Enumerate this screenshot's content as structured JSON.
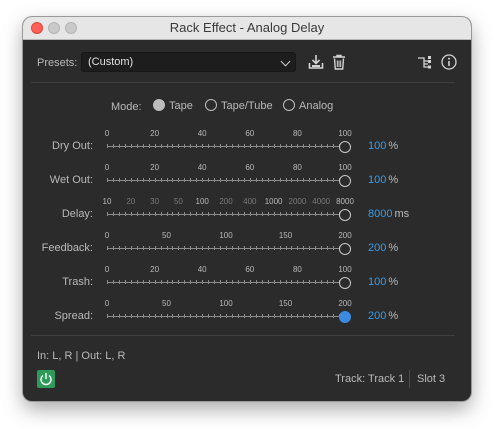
{
  "window": {
    "title": "Rack Effect - Analog Delay"
  },
  "presets": {
    "label": "Presets:",
    "value": "(Custom)",
    "icons": [
      "save-preset-icon",
      "trash-icon",
      "routing-icon",
      "info-icon"
    ]
  },
  "mode": {
    "label": "Mode:",
    "options": [
      {
        "label": "Tape",
        "selected": true
      },
      {
        "label": "Tape/Tube",
        "selected": false
      },
      {
        "label": "Analog",
        "selected": false
      }
    ]
  },
  "params": [
    {
      "label": "Dry Out:",
      "ticks": [
        "0",
        "20",
        "40",
        "60",
        "80",
        "100"
      ],
      "value": "100",
      "unit": "%",
      "fraction": 1.0,
      "active": false
    },
    {
      "label": "Wet Out:",
      "ticks": [
        "0",
        "20",
        "40",
        "60",
        "80",
        "100"
      ],
      "value": "100",
      "unit": "%",
      "fraction": 1.0,
      "active": false
    },
    {
      "label": "Delay:",
      "ticks": [
        "10",
        "20",
        "30",
        "50",
        "100",
        "200",
        "400",
        "1000",
        "2000",
        "4000",
        "8000"
      ],
      "value": "8000",
      "unit": "ms",
      "fraction": 1.0,
      "active": false
    },
    {
      "label": "Feedback:",
      "ticks": [
        "0",
        "50",
        "100",
        "150",
        "200"
      ],
      "value": "200",
      "unit": "%",
      "fraction": 1.0,
      "active": false
    },
    {
      "label": "Trash:",
      "ticks": [
        "0",
        "20",
        "40",
        "60",
        "80",
        "100"
      ],
      "value": "100",
      "unit": "%",
      "fraction": 1.0,
      "active": false
    },
    {
      "label": "Spread:",
      "ticks": [
        "0",
        "50",
        "100",
        "150",
        "200"
      ],
      "value": "200",
      "unit": "%",
      "fraction": 1.0,
      "active": true
    }
  ],
  "footer": {
    "io": "In: L, R | Out: L, R",
    "track": "Track: Track 1",
    "slot": "Slot 3"
  },
  "colors": {
    "accent": "#3b9be6",
    "power": "#2e9b5a",
    "panel": "#2b2b2b"
  }
}
